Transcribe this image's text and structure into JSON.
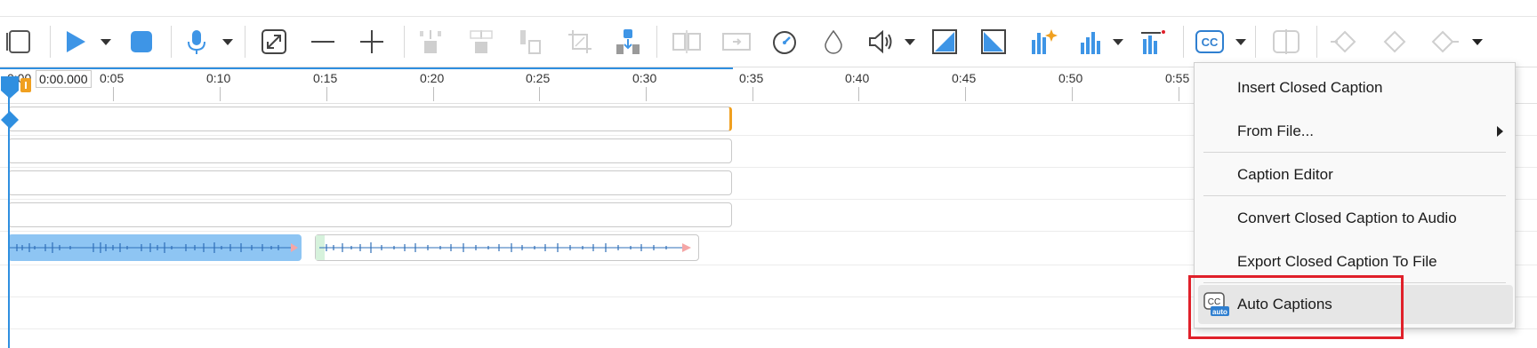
{
  "toolbar": {
    "buttons": [
      {
        "name": "select-frame-icon"
      },
      {
        "name": "play-icon"
      },
      {
        "name": "stop-icon"
      },
      {
        "name": "microphone-icon"
      },
      {
        "name": "fit-timeline-icon"
      },
      {
        "name": "zoom-out-icon"
      },
      {
        "name": "zoom-in-icon"
      },
      {
        "name": "insert-icon"
      },
      {
        "name": "overwrite-icon"
      },
      {
        "name": "delete-icon"
      },
      {
        "name": "crop-icon"
      },
      {
        "name": "trim-icon"
      },
      {
        "name": "split-icon"
      },
      {
        "name": "transition-icon"
      },
      {
        "name": "speed-icon"
      },
      {
        "name": "color-drop-icon"
      },
      {
        "name": "volume-icon"
      },
      {
        "name": "fade-in-icon"
      },
      {
        "name": "fade-out-icon"
      },
      {
        "name": "auto-level-icon"
      },
      {
        "name": "audio-levels-icon"
      },
      {
        "name": "noise-icon"
      },
      {
        "name": "captions-icon"
      },
      {
        "name": "compare-icon"
      },
      {
        "name": "keyframe-prev-icon"
      },
      {
        "name": "keyframe-add-icon"
      },
      {
        "name": "keyframe-next-icon"
      }
    ],
    "cc_label": "CC",
    "more_label": "▾",
    "accent": "#2f8fe0"
  },
  "ruler": {
    "timecode": "0:00.000",
    "start_label": "0:00",
    "labels": [
      "0:05",
      "0:10",
      "0:15",
      "0:20",
      "0:25",
      "0:30",
      "0:35",
      "0:40",
      "0:45",
      "0:50",
      "0:55"
    ]
  },
  "context_menu": {
    "items": [
      {
        "label": "Insert Closed Caption"
      },
      {
        "label": "From File...",
        "submenu": true
      },
      {
        "label": "Caption Editor"
      },
      {
        "label": "Convert Closed Caption to Audio"
      },
      {
        "label": "Export Closed Caption To File"
      },
      {
        "label": "Auto Captions",
        "highlighted": true,
        "icon": "cc-auto-icon"
      }
    ],
    "auto_icon_cc": "CC",
    "auto_icon_badge": "auto",
    "highlight_color": "#e0202a"
  }
}
